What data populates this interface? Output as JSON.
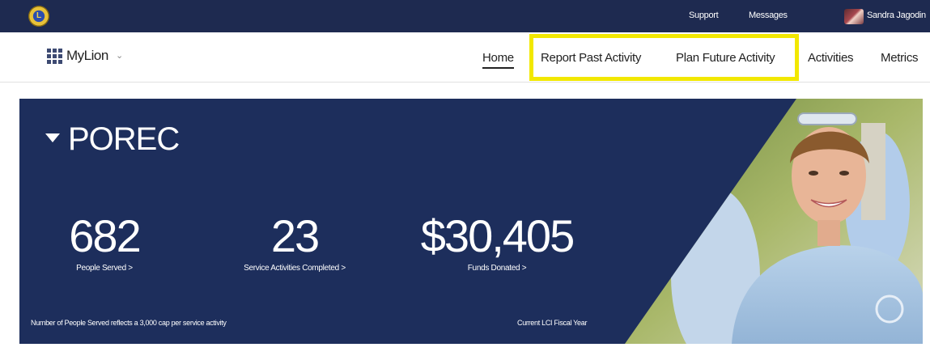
{
  "topbar": {
    "logo_text": "L",
    "support_label": "Support",
    "messages_label": "Messages",
    "user_name": "Sandra Jagodin"
  },
  "navbar": {
    "brand": "MyLion",
    "items": [
      {
        "label": "Home",
        "active": true
      },
      {
        "label": "Report Past Activity",
        "highlighted": true
      },
      {
        "label": "Plan Future Activity",
        "highlighted": true
      },
      {
        "label": "Activities"
      },
      {
        "label": "Metrics"
      }
    ],
    "highlight_color": "#f2e800"
  },
  "hero": {
    "club_name": "POREC",
    "stats": [
      {
        "value": "682",
        "label": "People Served >"
      },
      {
        "value": "23",
        "label": "Service Activities Completed >"
      },
      {
        "value": "$30,405",
        "label": "Funds Donated >"
      }
    ],
    "footnote_left": "Number of People Served reflects a 3,000 cap per service activity",
    "footnote_right": "Current LCI Fiscal Year",
    "background_color": "#1d2e5c"
  },
  "colors": {
    "topbar": "#1e2a50",
    "accent": "#1d2e5c"
  }
}
